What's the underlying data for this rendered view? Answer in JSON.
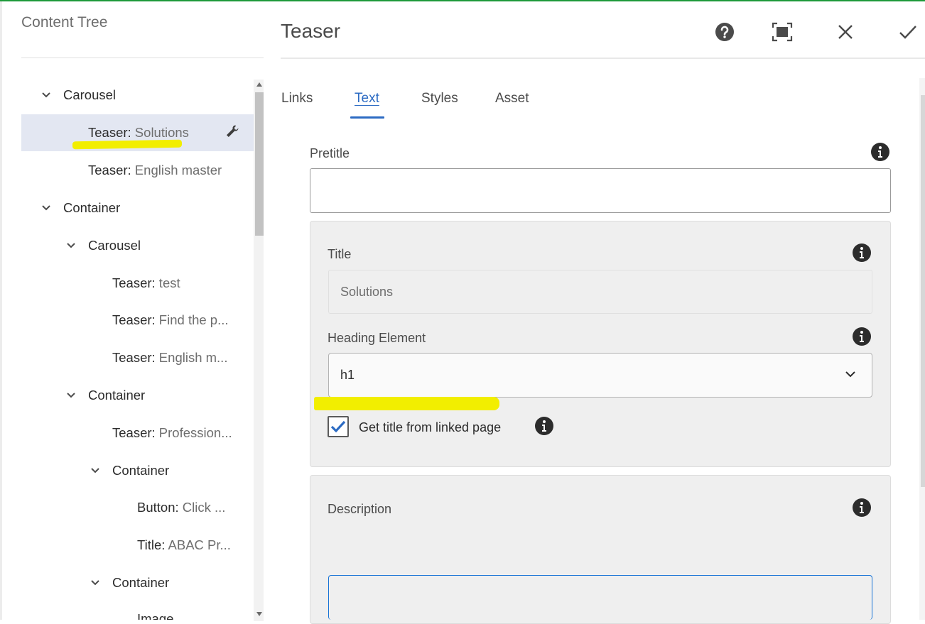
{
  "tree": {
    "title": "Content Tree",
    "items": [
      {
        "type": "Carousel",
        "name": "",
        "expanded": true
      },
      {
        "type": "Teaser:",
        "name": " Solutions",
        "selected": true
      },
      {
        "type": "Teaser:",
        "name": " English master"
      },
      {
        "type": "Container",
        "name": "",
        "expanded": true
      },
      {
        "type": "Carousel",
        "name": "",
        "expanded": true
      },
      {
        "type": "Teaser:",
        "name": " test"
      },
      {
        "type": "Teaser:",
        "name": " Find the p..."
      },
      {
        "type": "Teaser:",
        "name": " English m..."
      },
      {
        "type": "Container",
        "name": "",
        "expanded": true
      },
      {
        "type": "Teaser:",
        "name": " Profession..."
      },
      {
        "type": "Container",
        "name": "",
        "expanded": true
      },
      {
        "type": "Button:",
        "name": " Click ..."
      },
      {
        "type": "Title:",
        "name": " ABAC Pr..."
      },
      {
        "type": "Container",
        "name": "",
        "expanded": true
      },
      {
        "type": "Image",
        "name": ""
      }
    ]
  },
  "dialog": {
    "title": "Teaser",
    "tabs": [
      "Links",
      "Text",
      "Styles",
      "Asset"
    ],
    "active_tab": "Text",
    "pretitle": {
      "label": "Pretitle",
      "value": ""
    },
    "title_field": {
      "label": "Title",
      "value": "Solutions"
    },
    "heading": {
      "label": "Heading Element",
      "value": "h1"
    },
    "checkbox": {
      "label": "Get title from linked page",
      "checked": true
    },
    "description": {
      "label": "Description",
      "value": ""
    }
  },
  "colors": {
    "accent": "#2c6bc3",
    "highlight": "#f2ee00",
    "selected_row": "#e3e7f2",
    "top_bar": "#1e9a3a"
  }
}
